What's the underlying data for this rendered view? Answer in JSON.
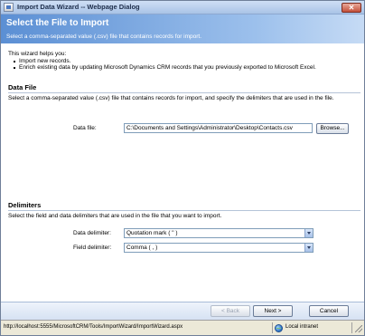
{
  "window": {
    "title": "Import Data Wizard -- Webpage Dialog",
    "close_label": "✕"
  },
  "header": {
    "title": "Select the File to Import",
    "subtitle": "Select a comma-separated value (.csv) file that contains records for import."
  },
  "intro": {
    "lead": "This wizard helps you:",
    "items": [
      "Import new records.",
      "Enrich existing data by updating Microsoft Dynamics CRM records that you previously exported to Microsoft Excel."
    ]
  },
  "data_file_section": {
    "title": "Data File",
    "description": "Select a comma-separated value (.csv) file that contains records for import, and specify the delimiters that are used in the file.",
    "field_label": "Data file:",
    "field_value": "C:\\Documents and Settings\\Administrator\\Desktop\\Contacts.csv",
    "browse_label": "Browse..."
  },
  "delimiters_section": {
    "title": "Delimiters",
    "description": "Select the field and data delimiters that are used in the file that you want to import.",
    "data_delimiter_label": "Data delimiter:",
    "data_delimiter_value": "Quotation mark ( \" )",
    "field_delimiter_label": "Field delimiter:",
    "field_delimiter_value": "Comma ( , )"
  },
  "footer": {
    "back_label": "< Back",
    "next_label": "Next >",
    "cancel_label": "Cancel"
  },
  "status": {
    "url": "http://localhost:5555/MicrosoftCRM/Tools/ImportWizard/ImportWizard.aspx",
    "zone": "Local intranet"
  }
}
